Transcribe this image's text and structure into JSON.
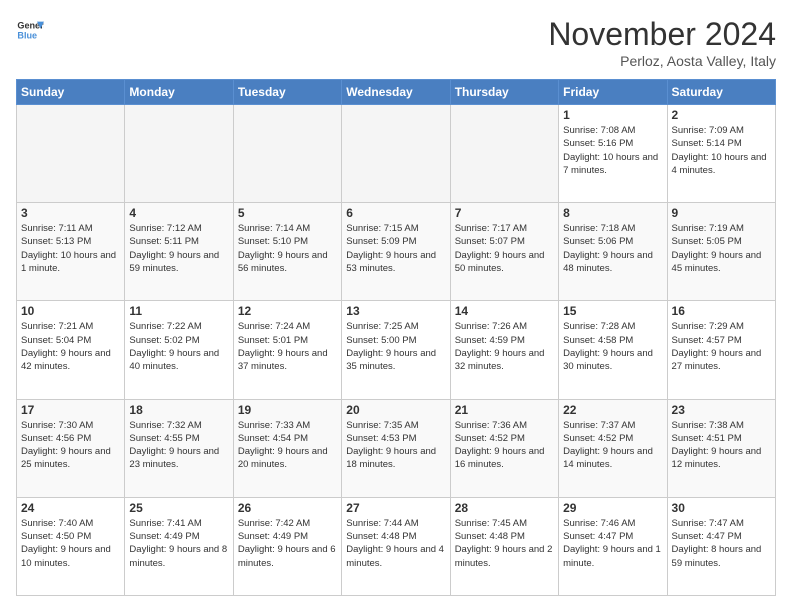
{
  "logo": {
    "line1": "General",
    "line2": "Blue"
  },
  "title": "November 2024",
  "location": "Perloz, Aosta Valley, Italy",
  "days_of_week": [
    "Sunday",
    "Monday",
    "Tuesday",
    "Wednesday",
    "Thursday",
    "Friday",
    "Saturday"
  ],
  "weeks": [
    [
      {
        "day": "",
        "info": ""
      },
      {
        "day": "",
        "info": ""
      },
      {
        "day": "",
        "info": ""
      },
      {
        "day": "",
        "info": ""
      },
      {
        "day": "",
        "info": ""
      },
      {
        "day": "1",
        "info": "Sunrise: 7:08 AM\nSunset: 5:16 PM\nDaylight: 10 hours and 7 minutes."
      },
      {
        "day": "2",
        "info": "Sunrise: 7:09 AM\nSunset: 5:14 PM\nDaylight: 10 hours and 4 minutes."
      }
    ],
    [
      {
        "day": "3",
        "info": "Sunrise: 7:11 AM\nSunset: 5:13 PM\nDaylight: 10 hours and 1 minute."
      },
      {
        "day": "4",
        "info": "Sunrise: 7:12 AM\nSunset: 5:11 PM\nDaylight: 9 hours and 59 minutes."
      },
      {
        "day": "5",
        "info": "Sunrise: 7:14 AM\nSunset: 5:10 PM\nDaylight: 9 hours and 56 minutes."
      },
      {
        "day": "6",
        "info": "Sunrise: 7:15 AM\nSunset: 5:09 PM\nDaylight: 9 hours and 53 minutes."
      },
      {
        "day": "7",
        "info": "Sunrise: 7:17 AM\nSunset: 5:07 PM\nDaylight: 9 hours and 50 minutes."
      },
      {
        "day": "8",
        "info": "Sunrise: 7:18 AM\nSunset: 5:06 PM\nDaylight: 9 hours and 48 minutes."
      },
      {
        "day": "9",
        "info": "Sunrise: 7:19 AM\nSunset: 5:05 PM\nDaylight: 9 hours and 45 minutes."
      }
    ],
    [
      {
        "day": "10",
        "info": "Sunrise: 7:21 AM\nSunset: 5:04 PM\nDaylight: 9 hours and 42 minutes."
      },
      {
        "day": "11",
        "info": "Sunrise: 7:22 AM\nSunset: 5:02 PM\nDaylight: 9 hours and 40 minutes."
      },
      {
        "day": "12",
        "info": "Sunrise: 7:24 AM\nSunset: 5:01 PM\nDaylight: 9 hours and 37 minutes."
      },
      {
        "day": "13",
        "info": "Sunrise: 7:25 AM\nSunset: 5:00 PM\nDaylight: 9 hours and 35 minutes."
      },
      {
        "day": "14",
        "info": "Sunrise: 7:26 AM\nSunset: 4:59 PM\nDaylight: 9 hours and 32 minutes."
      },
      {
        "day": "15",
        "info": "Sunrise: 7:28 AM\nSunset: 4:58 PM\nDaylight: 9 hours and 30 minutes."
      },
      {
        "day": "16",
        "info": "Sunrise: 7:29 AM\nSunset: 4:57 PM\nDaylight: 9 hours and 27 minutes."
      }
    ],
    [
      {
        "day": "17",
        "info": "Sunrise: 7:30 AM\nSunset: 4:56 PM\nDaylight: 9 hours and 25 minutes."
      },
      {
        "day": "18",
        "info": "Sunrise: 7:32 AM\nSunset: 4:55 PM\nDaylight: 9 hours and 23 minutes."
      },
      {
        "day": "19",
        "info": "Sunrise: 7:33 AM\nSunset: 4:54 PM\nDaylight: 9 hours and 20 minutes."
      },
      {
        "day": "20",
        "info": "Sunrise: 7:35 AM\nSunset: 4:53 PM\nDaylight: 9 hours and 18 minutes."
      },
      {
        "day": "21",
        "info": "Sunrise: 7:36 AM\nSunset: 4:52 PM\nDaylight: 9 hours and 16 minutes."
      },
      {
        "day": "22",
        "info": "Sunrise: 7:37 AM\nSunset: 4:52 PM\nDaylight: 9 hours and 14 minutes."
      },
      {
        "day": "23",
        "info": "Sunrise: 7:38 AM\nSunset: 4:51 PM\nDaylight: 9 hours and 12 minutes."
      }
    ],
    [
      {
        "day": "24",
        "info": "Sunrise: 7:40 AM\nSunset: 4:50 PM\nDaylight: 9 hours and 10 minutes."
      },
      {
        "day": "25",
        "info": "Sunrise: 7:41 AM\nSunset: 4:49 PM\nDaylight: 9 hours and 8 minutes."
      },
      {
        "day": "26",
        "info": "Sunrise: 7:42 AM\nSunset: 4:49 PM\nDaylight: 9 hours and 6 minutes."
      },
      {
        "day": "27",
        "info": "Sunrise: 7:44 AM\nSunset: 4:48 PM\nDaylight: 9 hours and 4 minutes."
      },
      {
        "day": "28",
        "info": "Sunrise: 7:45 AM\nSunset: 4:48 PM\nDaylight: 9 hours and 2 minutes."
      },
      {
        "day": "29",
        "info": "Sunrise: 7:46 AM\nSunset: 4:47 PM\nDaylight: 9 hours and 1 minute."
      },
      {
        "day": "30",
        "info": "Sunrise: 7:47 AM\nSunset: 4:47 PM\nDaylight: 8 hours and 59 minutes."
      }
    ]
  ]
}
